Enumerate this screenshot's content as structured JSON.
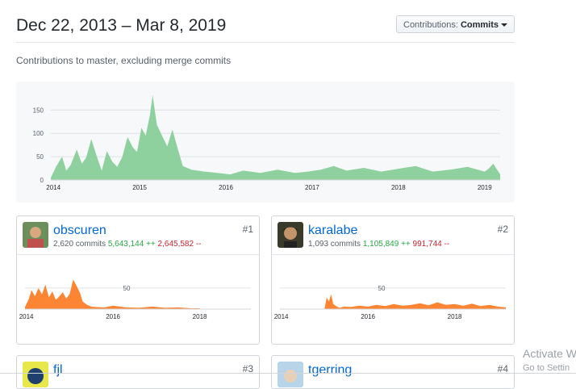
{
  "header": {
    "date_range": "Dec 22, 2013 – Mar 8, 2019",
    "select_label": "Contributions:",
    "select_value": "Commits"
  },
  "subtitle": "Contributions to master, excluding merge commits",
  "colors": {
    "main_area": "#8fd19e",
    "contributor_area": "#fb8532",
    "link": "#0366d6",
    "additions": "#28a745",
    "deletions": "#cb2431"
  },
  "chart_data": [
    {
      "type": "area",
      "ylim": [
        0,
        180
      ],
      "yticks": [
        "0",
        "50",
        "100",
        "150"
      ],
      "xticks": [
        "2014",
        "2015",
        "2016",
        "2017",
        "2018",
        "2019"
      ],
      "x_range": [
        2013.97,
        2019.18
      ],
      "series": [
        {
          "x": [
            2013.97,
            2014.03,
            2014.1,
            2014.15,
            2014.2,
            2014.27,
            2014.33,
            2014.38,
            2014.44,
            2014.5,
            2014.56,
            2014.62,
            2014.68,
            2014.74,
            2014.8,
            2014.86,
            2014.92,
            2014.97,
            2015.02,
            2015.07,
            2015.12,
            2015.15,
            2015.2,
            2015.26,
            2015.32,
            2015.38,
            2015.44,
            2015.5,
            2015.6,
            2015.75,
            2015.9,
            2016.05,
            2016.2,
            2016.4,
            2016.6,
            2016.8,
            2016.95,
            2017.1,
            2017.25,
            2017.4,
            2017.6,
            2017.8,
            2018.0,
            2018.2,
            2018.4,
            2018.6,
            2018.8,
            2019.0,
            2019.05,
            2019.1,
            2019.18
          ],
          "y": [
            5,
            28,
            50,
            20,
            32,
            65,
            35,
            48,
            88,
            52,
            20,
            62,
            40,
            28,
            50,
            92,
            70,
            60,
            112,
            95,
            140,
            182,
            118,
            95,
            72,
            108,
            68,
            30,
            22,
            18,
            15,
            12,
            20,
            15,
            22,
            15,
            18,
            22,
            30,
            20,
            26,
            18,
            24,
            30,
            18,
            22,
            28,
            18,
            25,
            35,
            12
          ]
        }
      ]
    },
    {
      "type": "area",
      "ylim": [
        0,
        90
      ],
      "yticks": [
        "50"
      ],
      "xticks": [
        "2014",
        "2016",
        "2018"
      ],
      "x_range": [
        2013.97,
        2019.18
      ],
      "series": [
        {
          "x": [
            2013.97,
            2014.05,
            2014.12,
            2014.2,
            2014.28,
            2014.36,
            2014.44,
            2014.52,
            2014.6,
            2014.68,
            2014.76,
            2014.84,
            2014.92,
            2015.0,
            2015.08,
            2015.16,
            2015.24,
            2015.3,
            2015.4,
            2015.5,
            2015.6,
            2015.8,
            2016.0,
            2016.3,
            2016.6,
            2016.9,
            2017.2,
            2017.5,
            2017.8,
            2018.0
          ],
          "y": [
            5,
            22,
            45,
            30,
            50,
            35,
            58,
            28,
            42,
            22,
            30,
            40,
            25,
            36,
            70,
            55,
            38,
            18,
            10,
            6,
            5,
            4,
            8,
            4,
            3,
            6,
            3,
            4,
            2,
            2
          ]
        }
      ]
    },
    {
      "type": "area",
      "ylim": [
        0,
        90
      ],
      "yticks": [
        "50"
      ],
      "xticks": [
        "2014",
        "2016",
        "2018"
      ],
      "x_range": [
        2013.97,
        2019.18
      ],
      "series": [
        {
          "x": [
            2015.0,
            2015.05,
            2015.1,
            2015.15,
            2015.2,
            2015.25,
            2015.3,
            2015.35,
            2015.45,
            2015.6,
            2015.8,
            2016.0,
            2016.2,
            2016.4,
            2016.6,
            2016.8,
            2017.0,
            2017.2,
            2017.4,
            2017.6,
            2017.8,
            2018.0,
            2018.2,
            2018.4,
            2018.6,
            2018.8,
            2019.0,
            2019.18
          ],
          "y": [
            2,
            28,
            18,
            35,
            12,
            8,
            5,
            3,
            6,
            5,
            8,
            6,
            10,
            7,
            12,
            8,
            10,
            14,
            9,
            16,
            10,
            12,
            8,
            13,
            7,
            10,
            6,
            4
          ]
        }
      ]
    }
  ],
  "contributors": [
    {
      "rank": "#1",
      "name": "obscuren",
      "commits": "2,620 commits",
      "additions": "5,643,144 ++",
      "deletions": "2,645,582 --"
    },
    {
      "rank": "#2",
      "name": "karalabe",
      "commits": "1,093 commits",
      "additions": "1,105,849 ++",
      "deletions": "991,744 --"
    },
    {
      "rank": "#3",
      "name": "fjl"
    },
    {
      "rank": "#4",
      "name": "tgerring"
    }
  ],
  "watermark": {
    "line1": "Activate W",
    "line2": "Go to Settin"
  }
}
